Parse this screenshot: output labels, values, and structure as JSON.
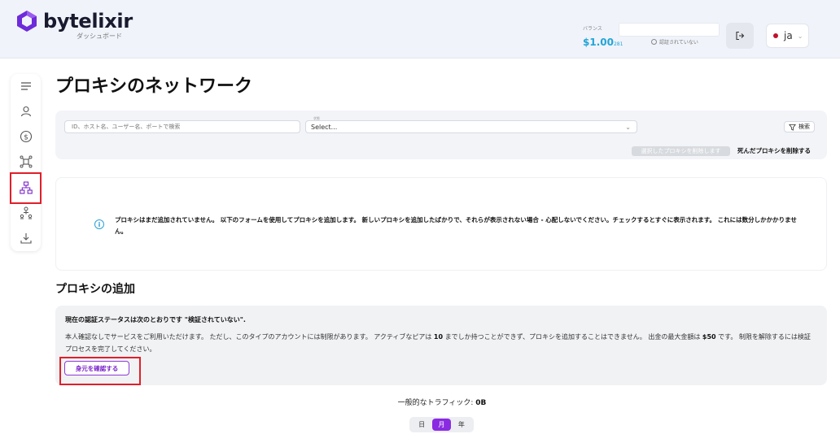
{
  "brand": {
    "name": "bytelixir",
    "subtitle": "ダッシュボード",
    "color": "#6d2bd9"
  },
  "header": {
    "balance_label": "バランス",
    "balance_value": "$1.00",
    "balance_unit": "281",
    "verify_status": "認証されていない",
    "language": "ja"
  },
  "sidebar": {
    "items": [
      {
        "icon": "menu-icon"
      },
      {
        "icon": "user-icon"
      },
      {
        "icon": "dollar-icon"
      },
      {
        "icon": "network-icon"
      },
      {
        "icon": "proxy-network-icon",
        "active": true
      },
      {
        "icon": "referral-icon"
      },
      {
        "icon": "download-icon"
      }
    ]
  },
  "page": {
    "title": "プロキシのネットワーク"
  },
  "filters": {
    "search_placeholder": "ID、ホスト名、ユーザー名、ポートで検索",
    "status_label": "状態",
    "status_value": "Select...",
    "search_button": "検索",
    "delete_selected": "選択したプロキシを削除します",
    "delete_dead": "死んだプロキシを削除する"
  },
  "info": {
    "message": "プロキシはまだ追加されていません。 以下のフォームを使用してプロキシを追加します。 新しいプロキシを追加したばかりで、それらが表示されない場合 - 心配しないでください。チェックするとすぐに表示されます。 これには数分しかかかりません。"
  },
  "add_proxy": {
    "title": "プロキシの追加",
    "status_heading": "現在の認証ステータスは次のとおりです \"検証されていない\".",
    "desc_part1": "本人確認なしでサービスをご利用いただけます。 ただし、このタイプのアカウントには制限があります。 アクティブなピアは ",
    "desc_peers": "10",
    "desc_part2": " までしか持つことができず、プロキシを追加することはできません。 出金の最大金額は ",
    "desc_amount": "$50",
    "desc_part3": " です。 制限を解除するには検証プロセスを完了してください。",
    "verify_button": "身元を確認する"
  },
  "traffic": {
    "label": "一般的なトラフィック:",
    "value": "0B"
  },
  "period": {
    "tabs": [
      "日",
      "月",
      "年"
    ],
    "active": "月"
  }
}
